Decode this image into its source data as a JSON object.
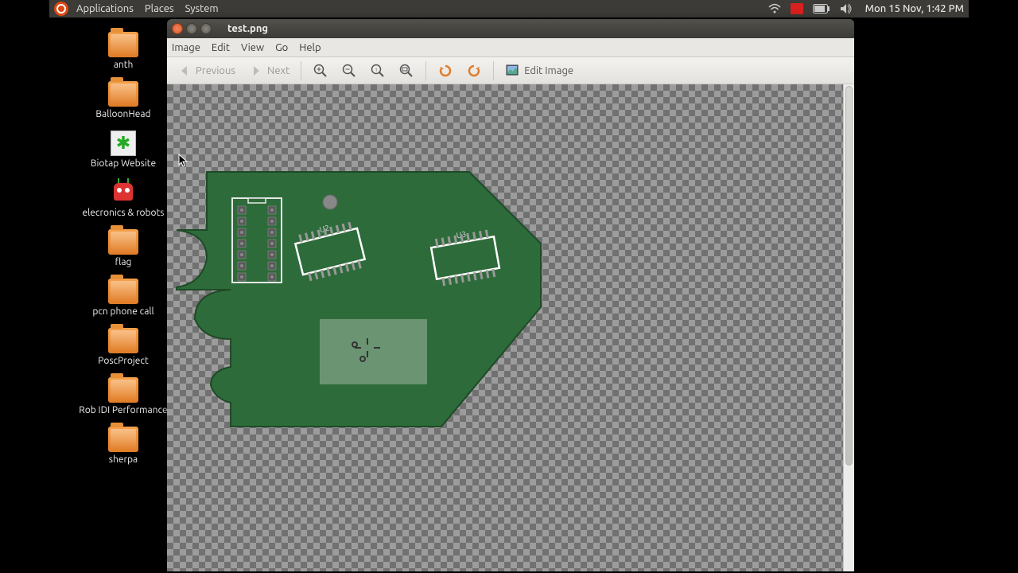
{
  "panel": {
    "menus": [
      "Applications",
      "Places",
      "System"
    ],
    "clock": "Mon 15 Nov,  1:42 PM"
  },
  "desktop_icons": [
    {
      "label": "anth",
      "kind": "folder"
    },
    {
      "label": "BalloonHead",
      "kind": "folder"
    },
    {
      "label": "Biotap Website",
      "kind": "biotap"
    },
    {
      "label": "elecronics & robots",
      "kind": "robot"
    },
    {
      "label": "flag",
      "kind": "folder"
    },
    {
      "label": "pcn phone call",
      "kind": "folder"
    },
    {
      "label": "PoscProject",
      "kind": "folder"
    },
    {
      "label": "Rob IDI Performance",
      "kind": "folder"
    },
    {
      "label": "sherpa",
      "kind": "folder"
    }
  ],
  "window": {
    "title": "test.png",
    "menus": [
      "Image",
      "Edit",
      "View",
      "Go",
      "Help"
    ],
    "toolbar": {
      "previous": "Previous",
      "next": "Next",
      "edit_image": "Edit Image"
    },
    "pcb": {
      "chip_u2": "U2",
      "chip_u3": "U3"
    }
  }
}
